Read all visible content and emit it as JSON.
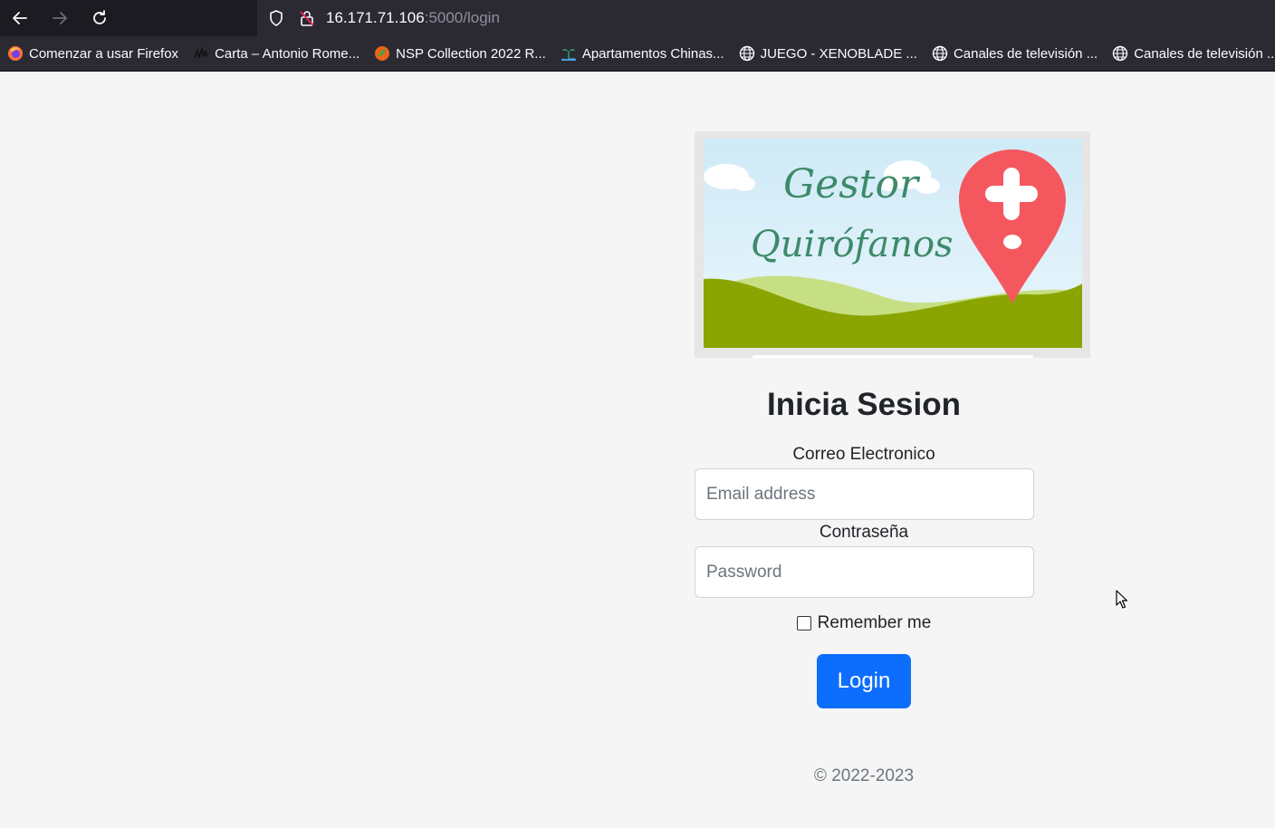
{
  "browser": {
    "url_host": "16.171.71.106",
    "url_path": ":5000/login",
    "bookmarks": [
      {
        "label": "Comenzar a usar Firefox",
        "icon": "firefox-icon"
      },
      {
        "label": "Carta – Antonio Rome...",
        "icon": "signature-icon"
      },
      {
        "label": "NSP Collection 2022 R...",
        "icon": "orange-leaf-icon"
      },
      {
        "label": "Apartamentos Chinas...",
        "icon": "palm-tree-icon"
      },
      {
        "label": "JUEGO - XENOBLADE ...",
        "icon": "globe-icon"
      },
      {
        "label": "Canales de televisión ...",
        "icon": "globe-icon"
      },
      {
        "label": "Canales de televisión ...",
        "icon": "globe-icon"
      }
    ]
  },
  "logo": {
    "line1": "Gestor",
    "line2": "Quirófanos"
  },
  "form": {
    "title": "Inicia Sesion",
    "email_label": "Correo Electronico",
    "email_placeholder": "Email address",
    "password_label": "Contraseña",
    "password_placeholder": "Password",
    "remember_label": "Remember me",
    "submit_label": "Login"
  },
  "footer": {
    "copyright": "© 2022-2023"
  },
  "colors": {
    "primary": "#0d6efd",
    "page_bg": "#f5f5f5",
    "logo_text": "#3d8a6a",
    "pin": "#f4585e"
  }
}
